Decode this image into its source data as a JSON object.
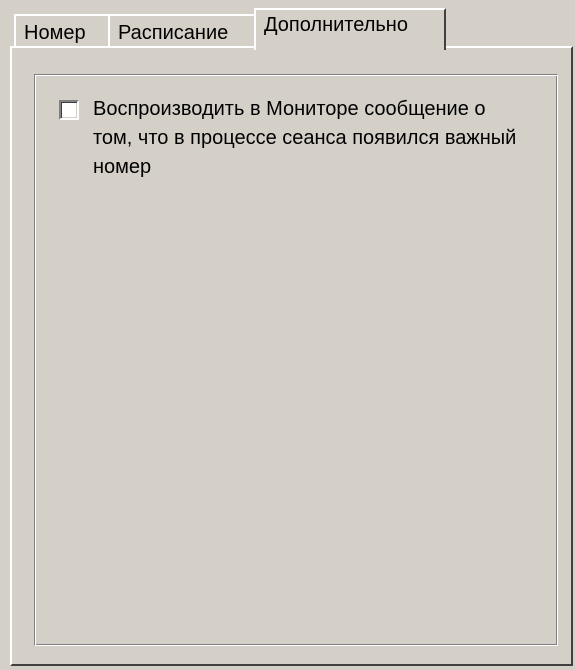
{
  "tabs": [
    {
      "label": "Номер",
      "active": false
    },
    {
      "label": "Расписание",
      "active": false
    },
    {
      "label": "Дополнительно",
      "active": true
    }
  ],
  "options": {
    "monitor_notify": {
      "label": "Воспроизводить в Мониторе сообщение о том, что в процессе сеанса появился важный номер",
      "checked": false
    }
  },
  "colors": {
    "window_background": "#d4d0c8",
    "highlight": "#ffffff",
    "shadow": "#808080",
    "dark_shadow": "#404040"
  }
}
